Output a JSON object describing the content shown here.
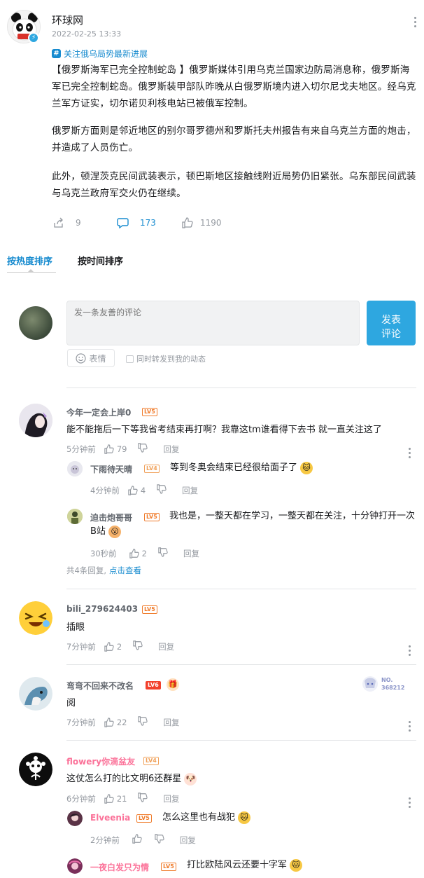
{
  "post": {
    "author": "环球网",
    "time": "2022-02-25 13:33",
    "topic": "关注俄乌局势最新进展",
    "paragraphs": [
      "【俄罗斯海军已完全控制蛇岛 】俄罗斯媒体引用乌克兰国家边防局消息称，俄罗斯海军已完全控制蛇岛。俄罗斯装甲部队昨晚从白俄罗斯境内进入切尔尼戈夫地区。经乌克兰军方证实，切尔诺贝利核电站已被俄军控制。",
      "俄罗斯方面则是邻近地区的别尔哥罗德州和罗斯托夫州报告有来自乌克兰方面的炮击，并造成了人员伤亡。",
      "此外，顿涅茨克民间武装表示，顿巴斯地区接触线附近局势仍旧紧张。乌东部民间武装与乌克兰政府军交火仍在继续。"
    ],
    "share_count": "9",
    "comment_count": "173",
    "like_count": "1190"
  },
  "sort_tabs": {
    "hot": "按热度排序",
    "time": "按时间排序"
  },
  "composer": {
    "placeholder": "发一条友善的评论",
    "send_label": "发表\n评论",
    "emoji_label": "表情",
    "forward_label": "同时转发到我的动态"
  },
  "reply_label": "回复",
  "comments": [
    {
      "user": "今年一定会上岸0",
      "level": "LV5",
      "text": "能不能拖后一下等我省考结束再打啊？我靠这tm谁看得下去书 就一直关注这了",
      "time": "5分钟前",
      "likes": "79",
      "replies": [
        {
          "user": "下雨待天晴",
          "level": "LV4",
          "text": "等到冬奥会结束已经很给面子了",
          "time": "4分钟前",
          "likes": "4"
        },
        {
          "user": "迫击炮哥哥",
          "level": "LV5",
          "text": "我也是，一整天都在学习，一整天都在关注，十分钟打开一次B站",
          "time": "30秒前",
          "likes": "2"
        }
      ],
      "more_prefix": "共4条回复,",
      "more_link": "点击查看"
    },
    {
      "user": "bili_279624403",
      "level": "LV5",
      "text": "插眼",
      "time": "7分钟前",
      "likes": "2"
    },
    {
      "user": "弯弯不回来不改名",
      "level": "LV6",
      "text": "阅",
      "time": "7分钟前",
      "likes": "22",
      "badge_no": "NO.",
      "badge_num": "368212"
    },
    {
      "user": "flowery你滴盆友",
      "level": "LV4",
      "text": "这仗怎么打的比文明6还群星",
      "time": "6分钟前",
      "likes": "21",
      "replies": [
        {
          "user": "Elveenia",
          "level": "LV5",
          "text": "怎么这里也有战犯",
          "time": "2分钟前",
          "likes": ""
        },
        {
          "user": "一夜白发只为情",
          "level": "LV5",
          "text": "打比欧陆风云还要十字军",
          "time": "",
          "likes": ""
        }
      ]
    }
  ],
  "colors": {
    "accent": "#178bcf",
    "send_button": "#2ea7e0",
    "vip_pink": "#fb7299",
    "lv4": "#f0a15a",
    "lv5": "#f07c2c",
    "lv6": "#f2402c"
  }
}
